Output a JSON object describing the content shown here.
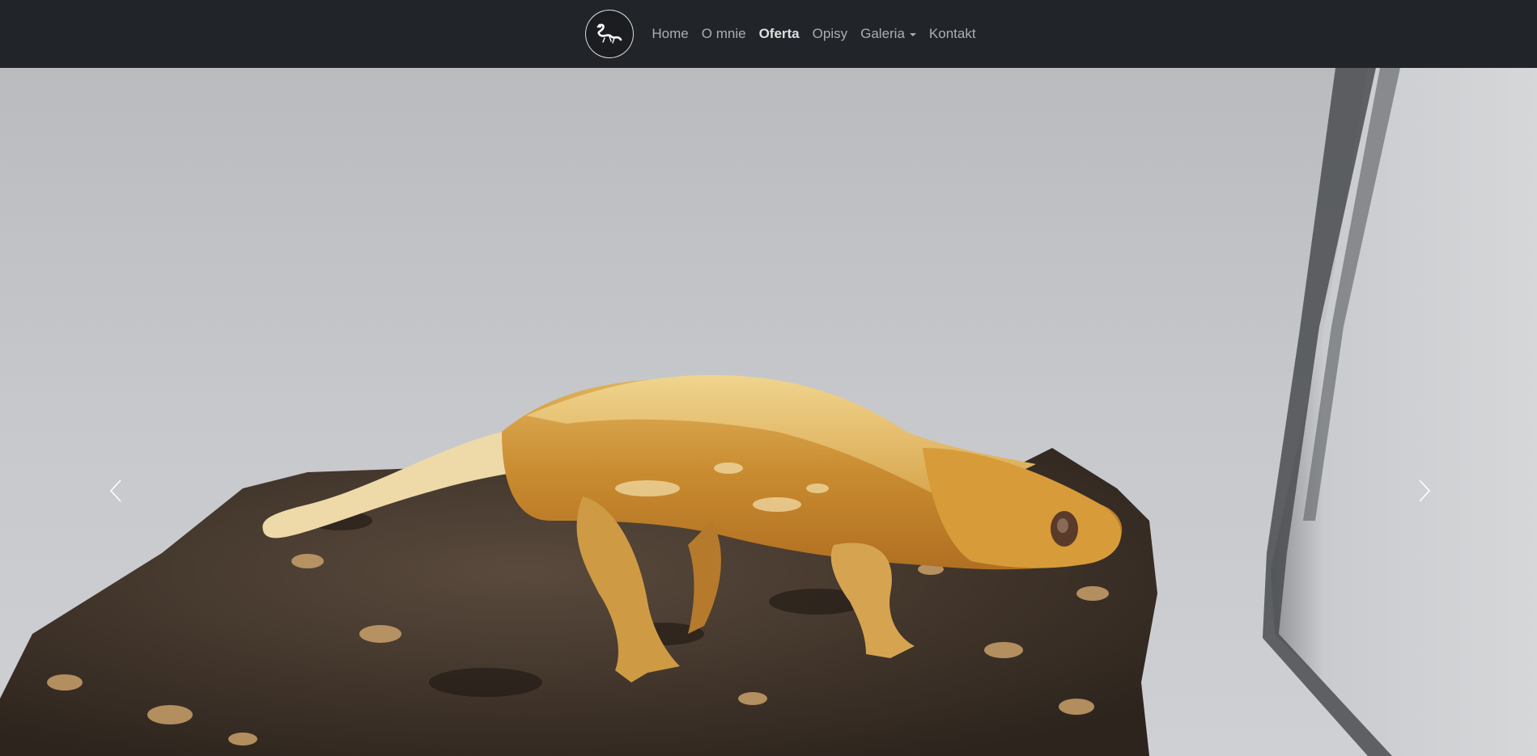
{
  "nav": {
    "logo_icon": "gecko-logo-icon",
    "items": [
      {
        "label": "Home",
        "active": false
      },
      {
        "label": "O mnie",
        "active": false
      },
      {
        "label": "Oferta",
        "active": true
      },
      {
        "label": "Opisy",
        "active": false
      },
      {
        "label": "Galeria",
        "active": false,
        "dropdown": true
      },
      {
        "label": "Kontakt",
        "active": false
      }
    ]
  },
  "carousel": {
    "prev_icon": "chevron-left-icon",
    "next_icon": "chevron-right-icon",
    "slide_image": "crested-gecko-on-cork-bark"
  },
  "colors": {
    "navbar_bg": "#212529",
    "nav_link": "rgba(255,255,255,0.62)",
    "nav_link_active": "rgba(255,255,255,0.85)"
  }
}
